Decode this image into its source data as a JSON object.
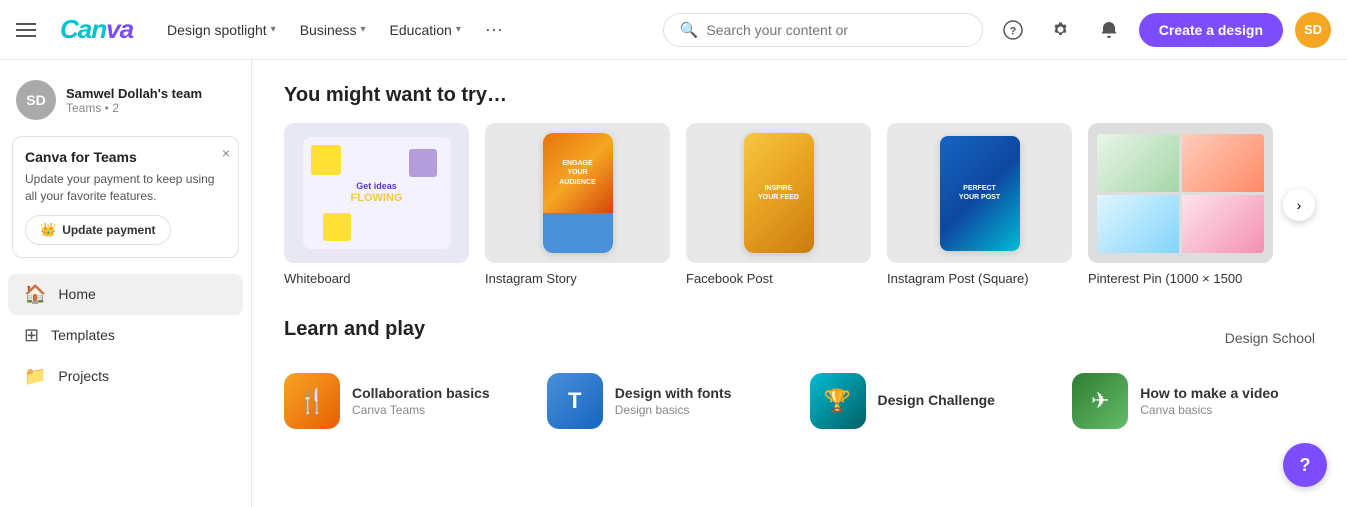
{
  "header": {
    "logo": "Canva",
    "nav": [
      {
        "label": "Design spotlight",
        "hasChevron": true
      },
      {
        "label": "Business",
        "hasChevron": true
      },
      {
        "label": "Education",
        "hasChevron": true
      }
    ],
    "nav_more": "···",
    "search_placeholder": "Search your content or",
    "create_btn": "Create a design",
    "avatar_initials": "SD",
    "help_circle": "?",
    "settings_icon": "⚙",
    "bell_icon": "🔔"
  },
  "sidebar": {
    "user": {
      "initials": "SD",
      "name": "Samwel Dollah's team",
      "team_label": "Teams • 2"
    },
    "promo": {
      "title": "Canva for Teams",
      "text": "Update your payment to keep using all your favorite features.",
      "btn_label": "Update payment",
      "close": "×"
    },
    "nav_items": [
      {
        "icon": "🏠",
        "label": "Home",
        "active": true
      },
      {
        "icon": "⊞",
        "label": "Templates",
        "active": false
      },
      {
        "icon": "📁",
        "label": "Projects",
        "active": false
      }
    ]
  },
  "main": {
    "try_section": {
      "title": "You might want to try…",
      "cards": [
        {
          "label": "Whiteboard",
          "type": "whiteboard",
          "text1": "Get ideas",
          "text2": "FLOWING"
        },
        {
          "label": "Instagram Story",
          "type": "instagram_story",
          "text1": "ENGAGE",
          "text2": "YOUR",
          "text3": "AUDIENCE"
        },
        {
          "label": "Facebook Post",
          "type": "facebook_post",
          "text1": "INSPIRE",
          "text2": "YOUR FEED"
        },
        {
          "label": "Instagram Post (Square)",
          "type": "instagram_square",
          "text1": "PERFECT",
          "text2": "YOUR POST"
        },
        {
          "label": "Pinterest Pin (1000 × 1500",
          "type": "pinterest"
        }
      ]
    },
    "learn_section": {
      "title": "Learn and play",
      "design_school_label": "Design School",
      "cards": [
        {
          "icon_type": "collab",
          "icon_emoji": "🍴",
          "title": "Collaboration basics",
          "subtitle": "Canva Teams"
        },
        {
          "icon_type": "fonts",
          "icon_emoji": "T",
          "title": "Design with fonts",
          "subtitle": "Design basics"
        },
        {
          "icon_type": "challenge",
          "icon_emoji": "🏆",
          "title": "Design Challenge",
          "subtitle": ""
        },
        {
          "icon_type": "video",
          "icon_emoji": "✈",
          "title": "How to make a video",
          "subtitle": "Canva basics"
        }
      ]
    }
  },
  "help_btn_label": "?"
}
